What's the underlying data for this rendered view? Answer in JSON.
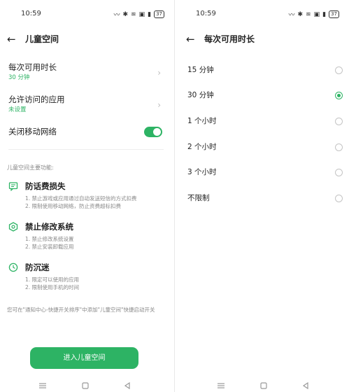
{
  "left": {
    "status": {
      "time": "10:59",
      "battery": "37"
    },
    "title": "儿童空间",
    "settings": [
      {
        "title": "每次可用时长",
        "value": "30 分钟"
      },
      {
        "title": "允许访问的应用",
        "value": "未设置"
      }
    ],
    "toggle": {
      "title": "关闭移动网络",
      "on": true
    },
    "section_label": "儿童空间主要功能:",
    "features": [
      {
        "icon": "message-icon",
        "title": "防话费损失",
        "lines": [
          "1. 禁止游戏或应用通过自动发送短信的方式扣费",
          "2. 限制使用移动网络，防止资费超标扣费"
        ]
      },
      {
        "icon": "settings-shield-icon",
        "title": "禁止修改系统",
        "lines": [
          "1. 禁止修改系统设置",
          "2. 禁止安装卸载应用"
        ]
      },
      {
        "icon": "clock-icon",
        "title": "防沉迷",
        "lines": [
          "1. 限定可以使用的应用",
          "2. 限制使用手机的时间"
        ]
      }
    ],
    "note": "您可在\"通知中心-快捷开关排序\"中添加\"儿童空间\"快捷启动开关",
    "enter_button": "进入儿童空间"
  },
  "right": {
    "status": {
      "time": "10:59",
      "battery": "37"
    },
    "title": "每次可用时长",
    "options": [
      {
        "label": "15 分钟",
        "selected": false
      },
      {
        "label": "30 分钟",
        "selected": true
      },
      {
        "label": "1 个小时",
        "selected": false
      },
      {
        "label": "2 个小时",
        "selected": false
      },
      {
        "label": "3 个小时",
        "selected": false
      },
      {
        "label": "不限制",
        "selected": false
      }
    ]
  },
  "colors": {
    "accent": "#2db364",
    "muted": "#888888"
  }
}
